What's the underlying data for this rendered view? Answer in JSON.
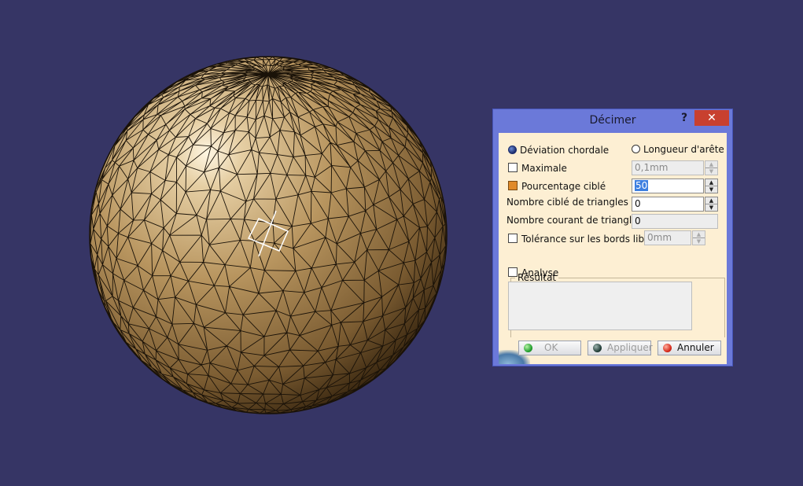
{
  "dialog": {
    "title": "Décimer",
    "help": "?",
    "close": "✕",
    "mode": {
      "chordal_label": "Déviation chordale",
      "chordal_selected": true,
      "edge_label": "Longueur d'arête",
      "edge_selected": false
    },
    "maximale": {
      "label": "Maximale",
      "checked": false,
      "value": "0,1mm"
    },
    "pourcentage": {
      "label": "Pourcentage ciblé",
      "checked": true,
      "value": "50"
    },
    "nombre_cible": {
      "label": "Nombre ciblé de triangles :",
      "value": "0"
    },
    "nombre_courant": {
      "label": "Nombre courant de triangles :",
      "value": "0"
    },
    "tolerance": {
      "label": "Tolérance sur les bords libres",
      "checked": false,
      "value": "0mm"
    },
    "resultat": {
      "label": "Résultat",
      "analyse_label": "Analyse",
      "analyse_checked": false
    },
    "buttons": {
      "ok": "OK",
      "appliquer": "Appliquer",
      "annuler": "Annuler"
    }
  },
  "colors": {
    "background": "#363565",
    "sphere": "#b8955f",
    "mesh": "#1a1208",
    "dialog_frame": "#6b79d9",
    "dialog_client": "#fdefd3",
    "close": "#c8402f"
  }
}
